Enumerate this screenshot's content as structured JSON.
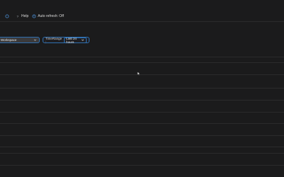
{
  "toolbar": {
    "help_label": "Help",
    "auto_refresh_label": "Auto refresh: Off"
  },
  "parameters": {
    "workspace_label": "Workspace",
    "time_range_label": "TimeRange :",
    "time_range_value": "Last 24 hours"
  },
  "colors": {
    "background": "#1b1b1c",
    "accent": "#2f6fb0",
    "divider": "#2b2b2c"
  }
}
